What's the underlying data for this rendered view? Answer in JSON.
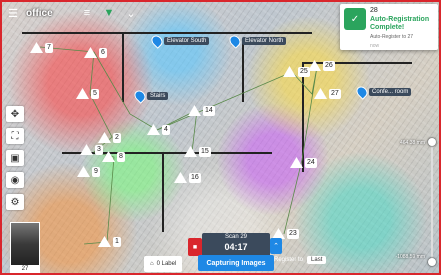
{
  "header": {
    "title": "office"
  },
  "toolbar": {
    "menu_icon": "hamburger-icon",
    "tools": [
      "layers-icon",
      "funnel-icon",
      "chevron-down-icon"
    ]
  },
  "left_tools": [
    "move-icon",
    "fit-icon",
    "cube-icon",
    "eye-icon",
    "settings-icon"
  ],
  "pois": [
    {
      "label": "Elevator South"
    },
    {
      "label": "Elevator North"
    },
    {
      "label": "Stairs"
    },
    {
      "label": "Confe... room"
    }
  ],
  "pins": [
    "7",
    "6",
    "5",
    "4",
    "2",
    "3",
    "8",
    "9",
    "14",
    "15",
    "16",
    "25",
    "26",
    "27",
    "24",
    "23",
    "1",
    "28"
  ],
  "notification": {
    "count": "28",
    "title": "Auto-Registration Complete!",
    "subtitle": "Auto-Register to 27",
    "meta": "Scan",
    "time": "now"
  },
  "slider": {
    "top_label": "464.38 mm",
    "bottom_label": "-1088.59 mm",
    "top_level": 0.0,
    "bottom_level": 1.0
  },
  "thumbnail": {
    "caption": "27"
  },
  "bottom": {
    "label_count": "0 Label",
    "scan_name": "Scan 29",
    "scan_time": "04:17",
    "capture_label": "Capturing Images",
    "register_label": "Register to",
    "register_value": "Last"
  },
  "colors": {
    "accent": "#1e88e5",
    "frame": "#d9262c",
    "success": "#2ba45d",
    "panel": "#3b4a5c"
  }
}
